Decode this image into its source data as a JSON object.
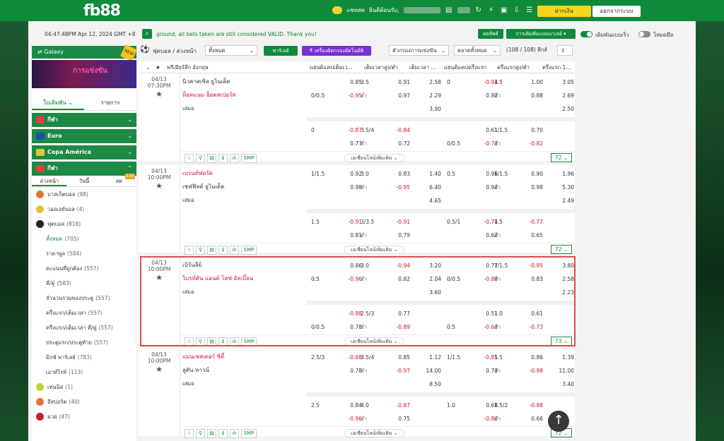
{
  "logo": {
    "main": "fb88",
    ".com": ".com"
  },
  "header": {
    "chat": "แชทสด",
    "welcome": "ยินดีต้อนรับ,",
    "deposit": "ฝากเงิน",
    "withdraw": "ออกจากระบบ"
  },
  "announcement": {
    "time": "04:47:48PM Apr 12, 2024 GMT +8",
    "text": "ground, all bets taken are still considered VALID. Thank you!"
  },
  "topcontrols": {
    "profile": "ผลลัพธ์",
    "bet_type": "การเดิมพันแบบมาเลย์",
    "quick_bet": "เดิมพันแบบเร็ว",
    "dark_mode": "โหมดมืด"
  },
  "colors": {
    "green": "#0f8a3b",
    "red": "#d0142c",
    "yellow": "#f7d51c"
  },
  "sidebar": {
    "galaxy": "Galaxy",
    "new_badge": "NEW",
    "banner": "การแข่งขัน",
    "tab_bet": "ใบเดิมพัน",
    "tab_list": "รายการ",
    "sections": [
      {
        "label": "กีฬา",
        "color": "#e04040"
      },
      {
        "label": "Euro",
        "color": "#1f4fa8"
      },
      {
        "label": "Copa América",
        "color": "#e8c23a"
      },
      {
        "label": "กีฬา",
        "color": "#e04040"
      }
    ],
    "modes": {
      "early": "ล่วงหน้า",
      "today": "วันนี้",
      "live": "สด",
      "live_count": "138"
    },
    "sports": [
      {
        "label": "บาสเก็ตบอล",
        "count": "(98)",
        "color": "#e0753a"
      },
      {
        "label": "วอลเลย์บอล",
        "count": "(4)",
        "color": "#e8c23a"
      },
      {
        "label": "ฟุตบอล",
        "count": "(818)",
        "color": "#222"
      }
    ],
    "sub": [
      {
        "label": "ทั้งหมด",
        "count": "(705)"
      },
      {
        "label": "ราคาพูล",
        "count": "(584)"
      },
      {
        "label": "คะแนนที่ถูกต้อง",
        "count": "(557)"
      },
      {
        "label": "คี่/คู่",
        "count": "(583)"
      },
      {
        "label": "จำนวนรวมของประตู",
        "count": "(557)"
      },
      {
        "label": "ครึ่งแรก/เต็มเวลา",
        "count": "(557)"
      },
      {
        "label": "ครึ่งแรก/เต็มเวลา คี่/คู่",
        "count": "(557)"
      },
      {
        "label": "ประตูแรก/ประตูท้าย",
        "count": "(557)"
      },
      {
        "label": "มิกซ์ พาร์เลย์",
        "count": "(783)"
      },
      {
        "label": "เอาท์ไรท์",
        "count": "(113)"
      }
    ],
    "others": [
      {
        "label": "เทนนิส",
        "count": "(1)",
        "color": "#b8d83a"
      },
      {
        "label": "อีสปอร์ต",
        "count": "(40)",
        "color": "#e0753a"
      },
      {
        "label": "มวย",
        "count": "(47)",
        "color": "#c0202a"
      }
    ]
  },
  "toolbar": {
    "breadcrumb": "ฟุตบอล / ล่วงหน้า",
    "all": "ทั้งหมด",
    "parlay": "พาร์เลย์",
    "calc": "เครื่องคิดกรองอัตโนมัติ",
    "filter": "ตัวกรองการแข่งขัน",
    "market": "ตลาดทั้งหมด",
    "league_count": "(108 / 108) ลีกส์"
  },
  "table": {
    "league": "พรีเมียร์ลีก อังกฤษ",
    "h1": "แฮนดิแคปเต็มเว...",
    "h2": "เต็มเวลาสูง/ต่ำ",
    "h3": "เต็มเวลา ...",
    "h4": "แฮนดิแคปครึ่งแรก",
    "h5": "ครึ่งแรกสูง/ต่ำ",
    "h6": "ครึ่งแรก 1..."
  },
  "footer": {
    "more": "เอเชียนไลน์เพิ่มเติม",
    "smp": "SMP"
  },
  "matches": [
    {
      "date": "04/13",
      "time": "07:30PM",
      "home": "นิวคาสเซิล ยูไนเต็ด",
      "away": "ท็อตแนม ฮ็อตสเปอร์ส",
      "draw": "เสมอ",
      "fav": "away",
      "count": "72",
      "r1": [
        "",
        "0.85",
        "3.5",
        "0.91",
        "2.58",
        "0",
        "-0.94",
        "1.5",
        "1.00",
        "3.05"
      ],
      "r2": [
        "0/0.5",
        "-0.95",
        "ต่ำ",
        "0.97",
        "2.29",
        "",
        "0.82",
        "ต่ำ",
        "0.88",
        "2.69"
      ],
      "r3": [
        "",
        "",
        "",
        "",
        "3.90",
        "",
        "",
        "",
        "",
        "2.50"
      ],
      "r4": [
        "0",
        "-0.87",
        "3.5/4",
        "-0.84",
        "",
        "",
        "0.61",
        "1/1.5",
        "0.70",
        ""
      ],
      "r5": [
        "",
        "0.77",
        "ต่ำ",
        "0.72",
        "",
        "0/0.5",
        "-0.73",
        "ต่ำ",
        "-0.82",
        ""
      ]
    },
    {
      "date": "04/13",
      "time": "10:00PM",
      "home": "เบรนท์ฟอร์ด",
      "away": "เชฟฟิลด์ ยูไนเต็ด",
      "draw": "เสมอ",
      "fav": "home",
      "count": "72",
      "r1": [
        "1/1.5",
        "0.92",
        "3.0",
        "0.83",
        "1.40",
        "0.5",
        "0.96",
        "1/1.5",
        "0.90",
        "1.96"
      ],
      "r2": [
        "",
        "0.98",
        "ต่ำ",
        "-0.95",
        "6.40",
        "",
        "0.92",
        "ต่ำ",
        "0.98",
        "5.30"
      ],
      "r3": [
        "",
        "",
        "",
        "",
        "4.65",
        "",
        "",
        "",
        "",
        "2.49"
      ],
      "r4": [
        "1.5",
        "-0.91",
        "3/3.5",
        "-0.91",
        "",
        "0.5/1",
        "-0.74",
        "1.5",
        "-0.77",
        ""
      ],
      "r5": [
        "",
        "0.81",
        "ต่ำ",
        "0.79",
        "",
        "",
        "0.62",
        "ต่ำ",
        "0.65",
        ""
      ]
    },
    {
      "date": "04/13",
      "time": "10:00PM",
      "home": "เบิร์นลีย์",
      "away": "ไบรท์ตัน แอนด์ โฮฟ อัลเบี้ยน",
      "draw": "เสมอ",
      "fav": "away",
      "count": "73",
      "r1": [
        "",
        "0.86",
        "3.0",
        "-0.94",
        "3.20",
        "",
        "0.77",
        "1/1.5",
        "-0.95",
        "3.80"
      ],
      "r2": [
        "0.5",
        "-0.96",
        "ต่ำ",
        "0.82",
        "2.04",
        "0/0.5",
        "-0.89",
        "ต่ำ",
        "0.83",
        "2.58"
      ],
      "r3": [
        "",
        "",
        "",
        "",
        "3.60",
        "",
        "",
        "",
        "",
        "2.23"
      ],
      "r4": [
        "",
        "-0.88",
        "2.5/3",
        "0.77",
        "",
        "",
        "0.51",
        "1.0",
        "0.61",
        ""
      ],
      "r5": [
        "0/0.5",
        "0.78",
        "ต่ำ",
        "-0.89",
        "",
        "0.5",
        "-0.63",
        "ต่ำ",
        "-0.73",
        ""
      ]
    },
    {
      "date": "04/13",
      "time": "10:00PM",
      "home": "แมนเชสเตอร์ ซิตี้",
      "away": "ลูตัน ทาวน์",
      "draw": "เสมอ",
      "fav": "home",
      "count": "72",
      "r1": [
        "2.5/3",
        "-0.88",
        "3.5/4",
        "0.85",
        "1.12",
        "1/1.5",
        "-0.85",
        "1.5",
        "0.86",
        "1.39"
      ],
      "r2": [
        "",
        "0.78",
        "ต่ำ",
        "-0.97",
        "14.00",
        "",
        "0.73",
        "ต่ำ",
        "-0.98",
        "11.00"
      ],
      "r3": [
        "",
        "",
        "",
        "",
        "8.50",
        "",
        "",
        "",
        "",
        "3.40"
      ],
      "r4": [
        "2.5",
        "0.84",
        "4.0",
        "-0.87",
        "",
        "1.0",
        "0.68",
        "1.5/2",
        "-0.88",
        ""
      ],
      "r5": [
        "",
        "-0.96",
        "ต่ำ",
        "0.75",
        "",
        "",
        "-0.80",
        "ต่ำ",
        "0.66",
        ""
      ]
    }
  ]
}
